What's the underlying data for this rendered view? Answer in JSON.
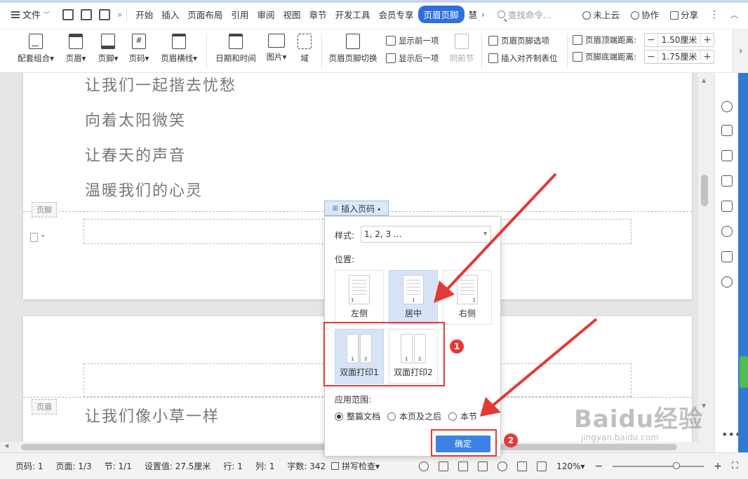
{
  "menubar": {
    "file_label": "文件",
    "tabs": [
      "开始",
      "插入",
      "页面布局",
      "引用",
      "审阅",
      "视图",
      "章节",
      "开发工具",
      "会员专享"
    ],
    "active_tab": "页眉页脚",
    "tab_overflow": "慧",
    "search_placeholder": "查找命令...",
    "cloud_label": "未上云",
    "collab_label": "协作",
    "share_label": "分享"
  },
  "ribbon": {
    "big_buttons": [
      {
        "id": "preset",
        "label": "配套组合▾"
      },
      {
        "id": "header",
        "label": "页眉▾"
      },
      {
        "id": "footer",
        "label": "页脚▾"
      },
      {
        "id": "pagenum",
        "label": "页码▾"
      },
      {
        "id": "headerline",
        "label": "页眉横线▾"
      },
      {
        "id": "datetime",
        "label": "日期和时间"
      },
      {
        "id": "picture",
        "label": "图片▾"
      },
      {
        "id": "field",
        "label": "域"
      },
      {
        "id": "switch",
        "label": "页眉页脚切换"
      }
    ],
    "show_prev": "显示前一项",
    "show_next": "显示后一项",
    "same_section": "同前节",
    "hf_options": "页眉页脚选项",
    "insert_tab": "插入对齐制表位",
    "header_dist_label": "页眉顶端距离:",
    "header_dist_value": "1.50厘米",
    "footer_dist_label": "页脚底端距离:",
    "footer_dist_value": "1.75厘米"
  },
  "document": {
    "poem_page1": [
      "让我们一起揩去忧愁",
      "向着太阳微笑",
      "让春天的声音",
      "温暖我们的心灵"
    ],
    "footer_label": "页脚",
    "header_label": "页眉",
    "poem_page2": [
      "让我们像小草一样"
    ]
  },
  "page_number_popup": {
    "button_label": "插入页码",
    "style_label": "样式:",
    "style_value": "1, 2, 3 ...",
    "position_label": "位置:",
    "positions": [
      "左侧",
      "居中",
      "右侧"
    ],
    "selected_position": "居中",
    "duplex": [
      "双面打印1",
      "双面打印2"
    ],
    "selected_duplex": "双面打印1",
    "scope_label": "应用范围:",
    "scopes": [
      "整篇文档",
      "本页及之后",
      "本节"
    ],
    "selected_scope": "整篇文档",
    "ok_label": "确定",
    "thumb_num": "1",
    "thumb_num_pair": [
      "1",
      "2"
    ],
    "badges": [
      "1",
      "2"
    ]
  },
  "statusbar": {
    "page_no": "页码: 1",
    "pages": "页面: 1/3",
    "section": "节: 1/1",
    "setting": "设置值: 27.5厘米",
    "row": "行: 1",
    "col": "列: 1",
    "words": "字数: 342",
    "spell": "拼写检查▾",
    "zoom": "120%▾"
  },
  "watermark": {
    "main": "Baidu经验",
    "sub": "jingyan.baidu.com"
  },
  "colors": {
    "accent": "#2f6fe0",
    "annotation_red": "#e53935",
    "ok_button": "#3c82e6",
    "selected_bg": "#d7e4f7"
  }
}
